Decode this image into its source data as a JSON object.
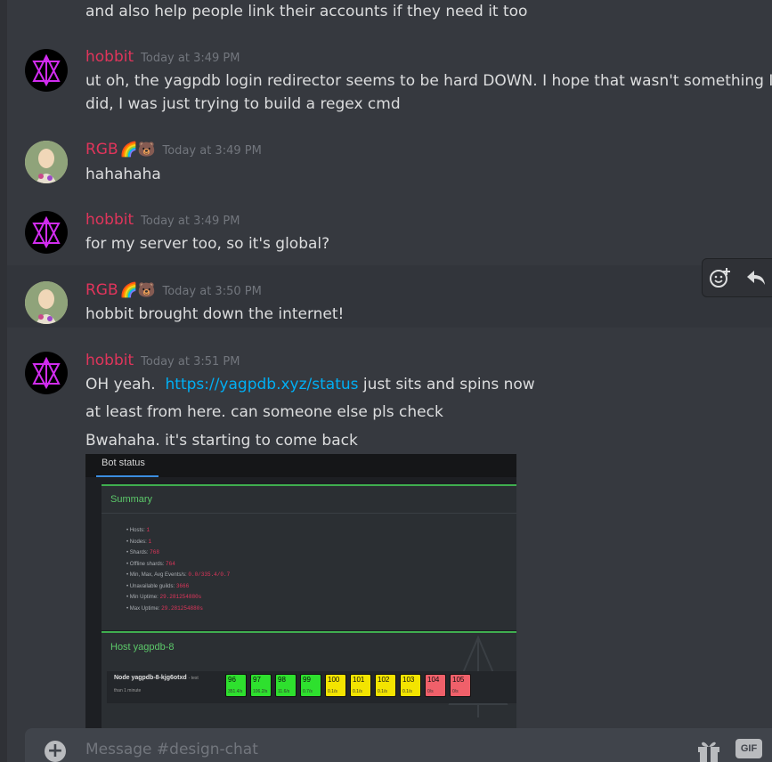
{
  "messages": {
    "m0_line": "and also help people link their accounts if they need it too",
    "g1": {
      "user": "hobbit",
      "time": "Today at 3:49 PM",
      "lines": [
        "ut oh, the yagpdb login redirector seems to be hard DOWN.  I hope that wasn't something I",
        "did, I was just trying to build a regex cmd"
      ]
    },
    "g2": {
      "user": "RGB",
      "emoji": "🌈🐻",
      "time": "Today at 3:49 PM",
      "line": "hahahaha"
    },
    "g3": {
      "user": "hobbit",
      "time": "Today at 3:49 PM",
      "line": "for my server too, so it's global?"
    },
    "g4": {
      "user": "RGB",
      "emoji": "🌈🐻",
      "time": "Today at 3:50 PM",
      "line": "hobbit brought down the internet!"
    },
    "g5": {
      "user": "hobbit",
      "time": "Today at 3:51 PM",
      "line1_pre": "OH yeah.  ",
      "line1_link": "https://yagpdb.xyz/status",
      "line1_post": " just sits and spins now",
      "line2": "at least from here.  can someone else pls check",
      "line3": "Bwahaha.  it's starting to come back"
    }
  },
  "embed": {
    "tab": "Bot status",
    "summary_title": "Summary",
    "stats": [
      {
        "label": "Hosts:",
        "value": "1"
      },
      {
        "label": "Nodes:",
        "value": "1"
      },
      {
        "label": "Shards:",
        "value": "768"
      },
      {
        "label": "Offline shards:",
        "value": "764"
      },
      {
        "label": "Min, Max, Avg Events/s:",
        "value": "0.0/335.4/0.7"
      },
      {
        "label": "Unavailable guilds:",
        "value": "3666"
      },
      {
        "label": "Min Uptime:",
        "value": "29.281254880s"
      },
      {
        "label": "Max Uptime:",
        "value": "29.281254880s"
      }
    ],
    "host_title": "Host yagpdb-8",
    "node_label": "Node yagpdb-8-kjg6otxd",
    "node_label_sub": "- test",
    "node_sub": "than 1 minute",
    "shards": [
      {
        "n": "96",
        "s": "351.4/s",
        "status": "g"
      },
      {
        "n": "97",
        "s": "106.2/s",
        "status": "g"
      },
      {
        "n": "98",
        "s": "11.6/s",
        "status": "g"
      },
      {
        "n": "99",
        "s": "0.7/s",
        "status": "g"
      },
      {
        "n": "100",
        "s": "0.1/s",
        "status": "y"
      },
      {
        "n": "101",
        "s": "0.1/s",
        "status": "y"
      },
      {
        "n": "102",
        "s": "0.1/s",
        "status": "y"
      },
      {
        "n": "103",
        "s": "0.1/s",
        "status": "y"
      },
      {
        "n": "104",
        "s": "0/s",
        "status": "r"
      },
      {
        "n": "105",
        "s": "0/s",
        "status": "r"
      }
    ]
  },
  "composer": {
    "placeholder": "Message #design-chat",
    "gif_label": "GIF"
  },
  "colors": {
    "username": "#e0355b",
    "link": "#00aff4",
    "background": "#36393f"
  }
}
